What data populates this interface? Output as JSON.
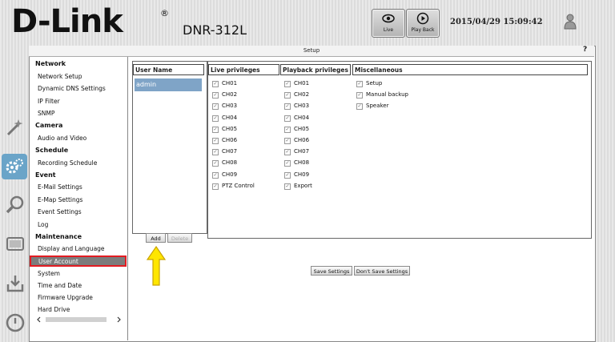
{
  "header": {
    "brand": "D-Link",
    "registered": "®",
    "model": "DNR-312L",
    "datetime": "2015/04/29 15:09:42",
    "live_label": "Live",
    "playback_label": "Play Back"
  },
  "window": {
    "title": "Setup",
    "help_icon": "question-icon"
  },
  "sidebar": {
    "sections": [
      {
        "label": "Network",
        "items": [
          "Network Setup",
          "Dynamic DNS Settings",
          "IP Filter",
          "SNMP"
        ]
      },
      {
        "label": "Camera",
        "items": [
          "Audio and Video"
        ]
      },
      {
        "label": "Schedule",
        "items": [
          "Recording Schedule"
        ]
      },
      {
        "label": "Event",
        "items": [
          "E-Mail Settings",
          "E-Map Settings",
          "Event Settings",
          "Log"
        ]
      },
      {
        "label": "Maintenance",
        "items": [
          "Display and Language",
          "User Account",
          "System",
          "Time and Date",
          "Firmware Upgrade",
          "Hard Drive"
        ]
      }
    ],
    "selected": "User Account"
  },
  "user_panel": {
    "header": "User Name",
    "users": [
      "admin"
    ],
    "add_label": "Add",
    "delete_label": "Delete"
  },
  "privileges": {
    "live_header": "Live privileges",
    "playback_header": "Playback privileges",
    "misc_header": "Miscellaneous",
    "live": [
      "CH01",
      "CH02",
      "CH03",
      "CH04",
      "CH05",
      "CH06",
      "CH07",
      "CH08",
      "CH09",
      "PTZ Control"
    ],
    "playback": [
      "CH01",
      "CH02",
      "CH03",
      "CH04",
      "CH05",
      "CH06",
      "CH07",
      "CH08",
      "CH09",
      "Export"
    ],
    "misc": [
      "Setup",
      "Manual backup",
      "Speaker"
    ]
  },
  "footer": {
    "save_label": "Save Settings",
    "dont_save_label": "Don't Save Settings"
  },
  "colors": {
    "selected_highlight": "#e21b22",
    "selected_row": "#7fa4c7",
    "arrow": "#ffe600"
  }
}
